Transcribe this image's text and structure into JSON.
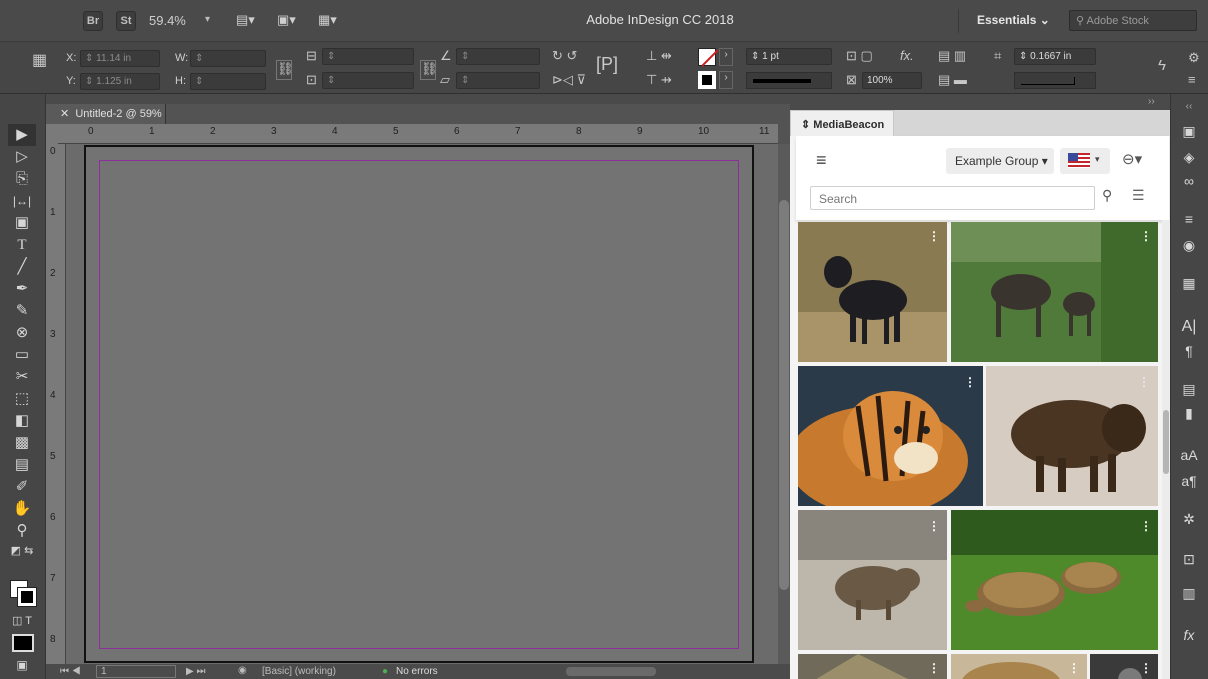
{
  "app": {
    "bridge_label": "Br",
    "stock_label": "St",
    "zoom": "59.4%",
    "title": "Adobe InDesign CC 2018",
    "workspace": "Essentials",
    "search_placeholder": "Adobe Stock"
  },
  "control": {
    "x_label": "X:",
    "x_value": "11.14 in",
    "y_label": "Y:",
    "y_value": "1.125 in",
    "w_label": "W:",
    "h_label": "H:",
    "stroke_weight": "1 pt",
    "opacity": "100%",
    "gap": "0.1667 in"
  },
  "document": {
    "tab_title": "Untitled-2 @ 59%",
    "h_ruler": [
      "0",
      "1",
      "2",
      "3",
      "4",
      "5",
      "6",
      "7",
      "8",
      "9",
      "10",
      "11"
    ],
    "v_ruler": [
      "0",
      "1",
      "2",
      "3",
      "4",
      "5",
      "6",
      "7",
      "8"
    ],
    "page_number": "1",
    "style": "[Basic] (working)",
    "preflight": "No errors"
  },
  "panel": {
    "tab_label": "MediaBeacon",
    "group": "Example Group",
    "search_placeholder": "Search"
  },
  "images": [
    {
      "name": "wolf-image",
      "color": "#5e5240"
    },
    {
      "name": "moose-image",
      "color": "#4a6b34"
    },
    {
      "name": "tiger-image",
      "color": "#b06b2c"
    },
    {
      "name": "bison-image",
      "color": "#6a5641"
    },
    {
      "name": "quokka-image",
      "color": "#8a8276"
    },
    {
      "name": "tortoise-image",
      "color": "#5a8a2c"
    },
    {
      "name": "partial-image-1",
      "color": "#7a7a6a"
    },
    {
      "name": "partial-image-2",
      "color": "#a9854d"
    },
    {
      "name": "partial-image-3",
      "color": "#6d6d6d"
    }
  ],
  "colors": {
    "accent_margin": "#8b2f9b",
    "panel_bg": "#f4f4f4"
  }
}
